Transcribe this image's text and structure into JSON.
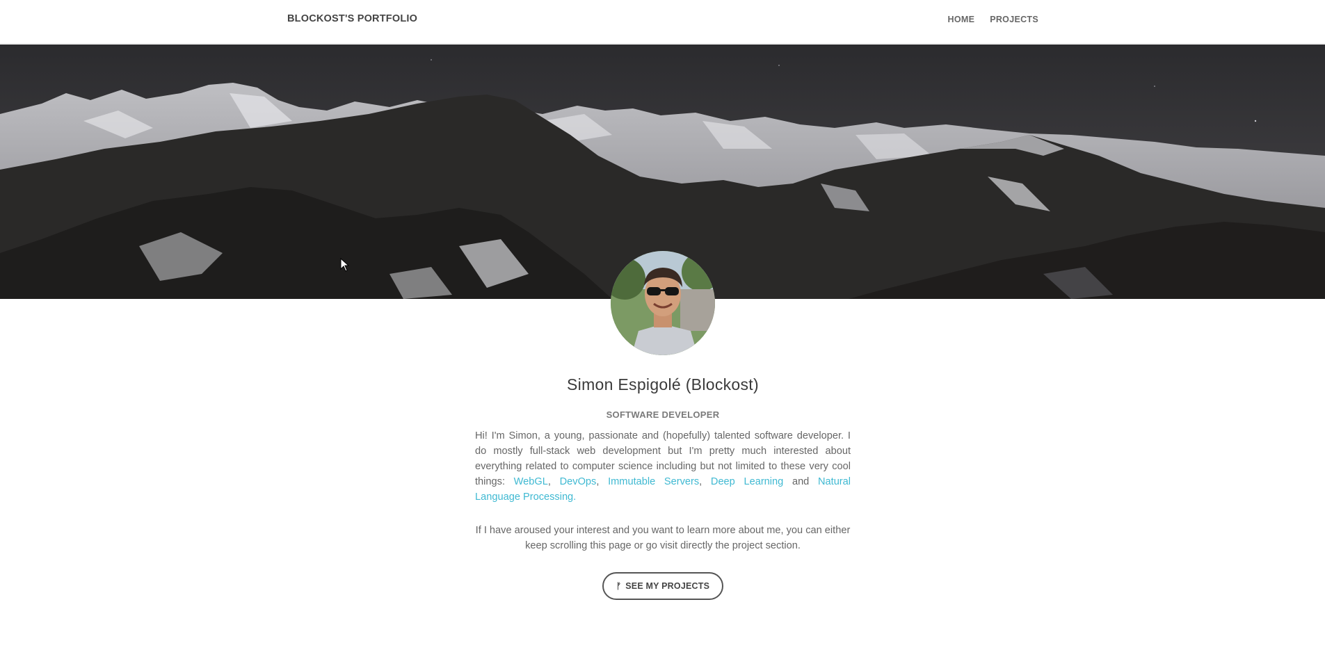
{
  "navbar": {
    "brand": "BLOCKOST'S PORTFOLIO",
    "links": [
      {
        "label": "HOME"
      },
      {
        "label": "PROJECTS"
      }
    ]
  },
  "profile": {
    "name": "Simon Espigolé (Blockost)",
    "role": "SOFTWARE DEVELOPER"
  },
  "bio": {
    "intro": "Hi! I'm Simon, a young, passionate and (hopefully) talented software developer. I do mostly full-stack web development but I'm pretty much interested about everything related to computer science including but not limited to these very cool things: ",
    "links": [
      "WebGL",
      "DevOps",
      "Immutable Servers",
      "Deep Learning",
      "Natural Language Processing."
    ],
    "sep1": ", ",
    "sep2": ", ",
    "sep3": ", ",
    "and": " and "
  },
  "note": "If I have aroused your interest and you want to learn more about me, you can either keep scrolling this page or go visit directly the project section.",
  "cta": {
    "icon": "code-branch-icon",
    "icon_glyph": "ᚠ",
    "label": "SEE MY PROJECTS"
  },
  "colors": {
    "link": "#3fb9d2",
    "text": "#666666",
    "heading": "#3a3a3a"
  }
}
